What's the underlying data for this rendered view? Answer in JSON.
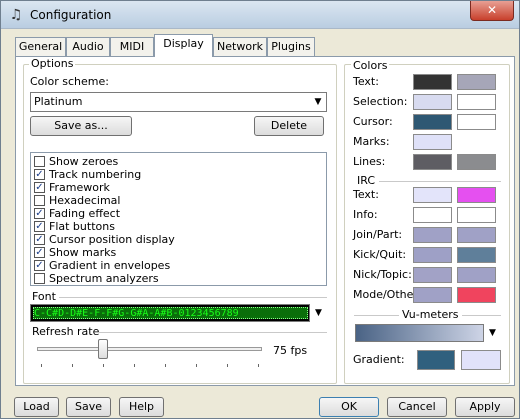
{
  "window": {
    "title": "Configuration"
  },
  "tabs": [
    {
      "label": "General"
    },
    {
      "label": "Audio"
    },
    {
      "label": "MIDI"
    },
    {
      "label": "Display"
    },
    {
      "label": "Network"
    },
    {
      "label": "Plugins"
    }
  ],
  "options": {
    "group_label": "Options",
    "color_scheme_label": "Color scheme:",
    "color_scheme_value": "Platinum",
    "save_as_label": "Save as...",
    "delete_label": "Delete",
    "checkboxes": [
      {
        "label": "Show zeroes",
        "checked": false
      },
      {
        "label": "Track numbering",
        "checked": true
      },
      {
        "label": "Framework",
        "checked": true
      },
      {
        "label": "Hexadecimal",
        "checked": false
      },
      {
        "label": "Fading effect",
        "checked": true
      },
      {
        "label": "Flat buttons",
        "checked": true
      },
      {
        "label": "Cursor position display",
        "checked": true
      },
      {
        "label": "Show marks",
        "checked": true
      },
      {
        "label": "Gradient in envelopes",
        "checked": true
      },
      {
        "label": "Spectrum analyzers",
        "checked": false
      }
    ],
    "font_label": "Font",
    "font_sample": "C-C#D-D#E-F-F#G-G#A-A#B-0123456789",
    "refresh_label": "Refresh rate",
    "refresh_value": "75 fps"
  },
  "colors": {
    "group_label": "Colors",
    "rows": [
      {
        "label": "Text:",
        "c1": "#333333",
        "c2": "#a6a6b8"
      },
      {
        "label": "Selection:",
        "c1": "#d8dbf0",
        "c2": "#ffffff"
      },
      {
        "label": "Cursor:",
        "c1": "#2e5873",
        "c2": "#ffffff"
      },
      {
        "label": "Marks:",
        "c1": "#dfe1f8",
        "c2": ""
      },
      {
        "label": "Lines:",
        "c1": "#5e5d63",
        "c2": "#8b8c8f"
      }
    ],
    "irc_label": "IRC",
    "irc_rows": [
      {
        "label": "Text:",
        "c1": "#e3e4fa",
        "c2": "#e550f0"
      },
      {
        "label": "Info:",
        "c1": "#ffffff",
        "c2": "#ffffff"
      },
      {
        "label": "Join/Part:",
        "c1": "#a0a1c6",
        "c2": "#a0a1c6"
      },
      {
        "label": "Kick/Quit:",
        "c1": "#9ea0c6",
        "c2": "#5f7f9a"
      },
      {
        "label": "Nick/Topic:",
        "c1": "#a2a2c6",
        "c2": "#a0a1c6"
      },
      {
        "label": "Mode/Othe",
        "c1": "#a0a1c6",
        "c2": "#f0445e"
      }
    ],
    "vu_label": "Vu-meters",
    "gradient_label": "Gradient:",
    "gradient_c1": "#30607e",
    "gradient_c2": "#e1e2fa"
  },
  "footer": {
    "load": "Load",
    "save": "Save",
    "help": "Help",
    "ok": "OK",
    "cancel": "Cancel",
    "apply": "Apply"
  }
}
